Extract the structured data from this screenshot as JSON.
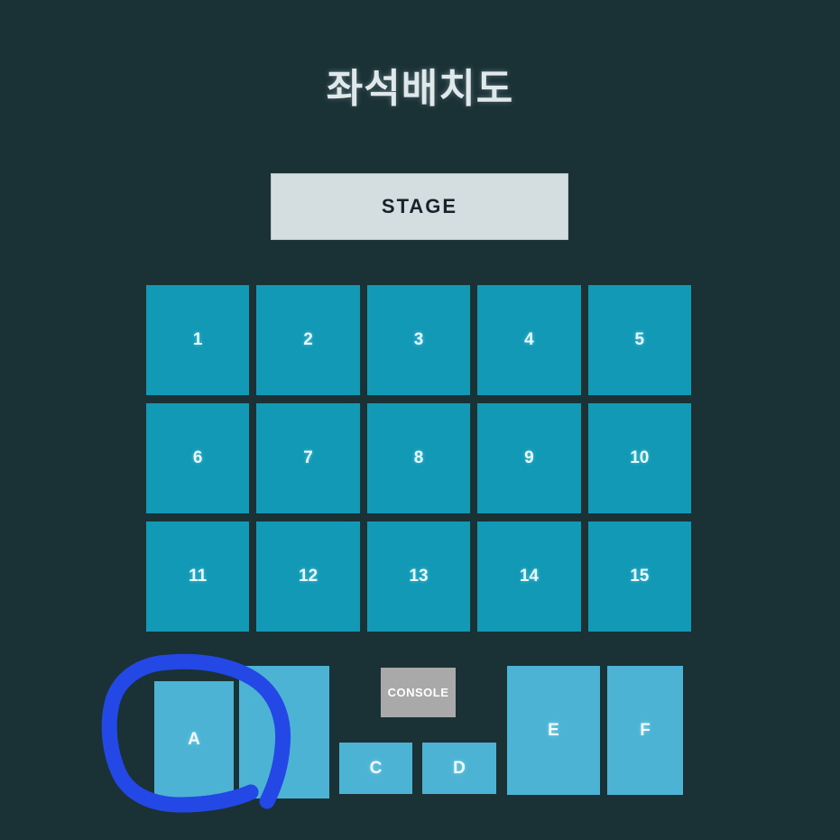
{
  "page": {
    "title": "좌석배치도",
    "background_color": "#1a3136"
  },
  "stage": {
    "label": "STAGE",
    "color": "#d4dddf"
  },
  "seating": {
    "numbered_block_color": "#1299b5",
    "lettered_block_color": "#4cb3d4",
    "rows": [
      {
        "blocks": [
          "1",
          "2",
          "3",
          "4",
          "5"
        ]
      },
      {
        "blocks": [
          "6",
          "7",
          "8",
          "9",
          "10"
        ]
      },
      {
        "blocks": [
          "11",
          "12",
          "13",
          "14",
          "15"
        ]
      }
    ],
    "zones": [
      {
        "id": "a",
        "label": "A"
      },
      {
        "id": "b",
        "label": ""
      },
      {
        "id": "c",
        "label": "C"
      },
      {
        "id": "d",
        "label": "D"
      },
      {
        "id": "e",
        "label": "E"
      },
      {
        "id": "f",
        "label": "F"
      }
    ]
  },
  "console": {
    "label": "CONSOLE",
    "color": "#a9a9a9"
  },
  "annotation": {
    "type": "hand-drawn-circle",
    "target": "A",
    "color": "#2348e6"
  }
}
